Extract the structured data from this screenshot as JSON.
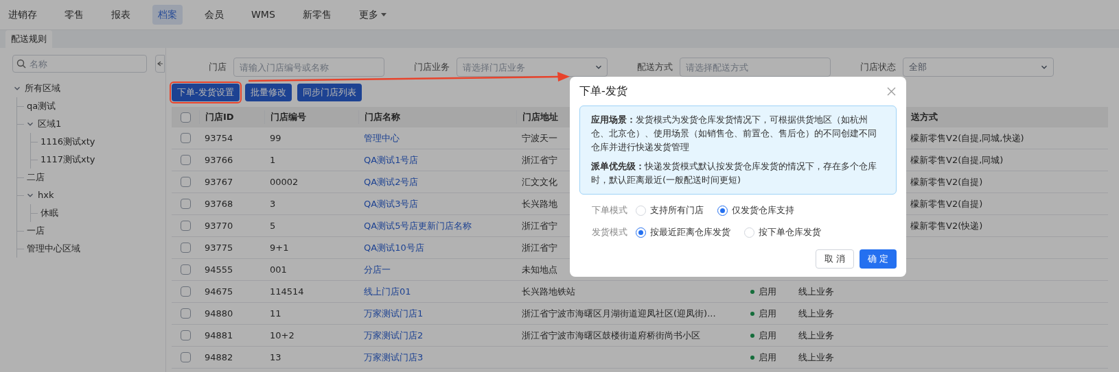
{
  "top_nav": [
    {
      "label": "进销存",
      "selected": false,
      "caret": false
    },
    {
      "label": "零售",
      "selected": false,
      "caret": false
    },
    {
      "label": "报表",
      "selected": false,
      "caret": false
    },
    {
      "label": "档案",
      "selected": true,
      "caret": false
    },
    {
      "label": "会员",
      "selected": false,
      "caret": false
    },
    {
      "label": "WMS",
      "selected": false,
      "caret": false
    },
    {
      "label": "新零售",
      "selected": false,
      "caret": false
    },
    {
      "label": "更多",
      "selected": false,
      "caret": true
    }
  ],
  "tabs": [
    {
      "label": "配送规则",
      "selected": true
    }
  ],
  "sidebar": {
    "search_placeholder": "名称",
    "tree": [
      {
        "label": "所有区域",
        "expanded": true,
        "children": [
          {
            "label": "qa测试"
          },
          {
            "label": "区域1",
            "expanded": true,
            "children": [
              {
                "label": "1116测试xty"
              },
              {
                "label": "1117测试xty"
              }
            ]
          },
          {
            "label": "二店"
          },
          {
            "label": "hxk",
            "expanded": true,
            "children": [
              {
                "label": "休眠"
              }
            ]
          },
          {
            "label": "一店"
          },
          {
            "label": "管理中心区域"
          }
        ]
      }
    ]
  },
  "filters": [
    {
      "label": "门店",
      "kind": "input",
      "placeholder": "请输入门店编号或名称"
    },
    {
      "label": "门店业务",
      "kind": "select",
      "placeholder": "请选择门店业务"
    },
    {
      "label": "配送方式",
      "kind": "input",
      "placeholder": "请选择配送方式"
    },
    {
      "label": "门店状态",
      "kind": "select",
      "value": "全部"
    }
  ],
  "actions": [
    {
      "label": "下单-发货设置",
      "highlighted": true
    },
    {
      "label": "批量修改",
      "highlighted": false
    },
    {
      "label": "同步门店列表",
      "highlighted": false
    }
  ],
  "table": {
    "all_checked": false,
    "columns": [
      "门店ID",
      "门店编号",
      "门店名称",
      "门店地址",
      null,
      null,
      "送方式"
    ],
    "rows": [
      {
        "checked": false,
        "cells": [
          "93754",
          "99",
          "管理中心",
          "宁波天一",
          null,
          null,
          "檬新零售V2(自提,同城,快递)"
        ]
      },
      {
        "checked": false,
        "cells": [
          "93766",
          "1",
          "QA测试1号店",
          "浙江省宁",
          null,
          null,
          "檬新零售V2(自提,同城)"
        ]
      },
      {
        "checked": false,
        "cells": [
          "93767",
          "00002",
          "QA测试2号店",
          "汇文文化",
          null,
          null,
          "檬新零售V2(自提)"
        ]
      },
      {
        "checked": false,
        "cells": [
          "93768",
          "3",
          "QA测试3号店",
          "长兴路地",
          null,
          null,
          "檬新零售V2(自提)"
        ]
      },
      {
        "checked": false,
        "cells": [
          "93770",
          "5",
          "QA测试5号店更新门店名称",
          "浙江省宁",
          null,
          null,
          "檬新零售V2(快递)"
        ]
      },
      {
        "checked": false,
        "cells": [
          "93775",
          "9+1",
          "QA测试10号店",
          "浙江省宁",
          null,
          null,
          null
        ]
      },
      {
        "checked": false,
        "cells": [
          "94555",
          "001",
          "分店一",
          "未知地点",
          null,
          null,
          null
        ]
      },
      {
        "checked": false,
        "cells": [
          "94675",
          "114514",
          "线上门店01",
          "长兴路地铁站",
          "启用",
          "线上业务",
          null
        ]
      },
      {
        "checked": false,
        "cells": [
          "94880",
          "11",
          "万家测试门店1",
          "浙江省宁波市海曙区月湖街道迎凤社区(迎凤街)...",
          "启用",
          "线上业务",
          null
        ]
      },
      {
        "checked": false,
        "cells": [
          "94881",
          "10+2",
          "万家测试门店2",
          "浙江省宁波市海曙区鼓楼街道府桥街尚书小区",
          "启用",
          "线上业务",
          null
        ]
      },
      {
        "checked": false,
        "cells": [
          "94882",
          "13",
          "万家测试门店3",
          null,
          "启用",
          "线上业务",
          null
        ]
      }
    ]
  },
  "modal": {
    "title": "下单-发货",
    "info": [
      "**应用场景：**发货模式为发货仓库发货情况下，可根据供货地区（如杭州仓、北京仓）、使用场景（如销售仓、前置仓、售后仓）的不同创建不同仓库并进行快递发货管理",
      "**派单优先级：**快递发货模式默认按发货仓库发货的情况下，存在多个仓库时，默认距离最近(一般配送时间更短)"
    ],
    "radio_groups": [
      {
        "label": "下单模式",
        "options": [
          {
            "label": "支持所有门店",
            "selected": false
          },
          {
            "label": "仅发货仓库支持",
            "selected": true
          }
        ]
      },
      {
        "label": "发货模式",
        "options": [
          {
            "label": "按最近距离仓库发货",
            "selected": true
          },
          {
            "label": "按下单仓库发货",
            "selected": false
          }
        ]
      }
    ],
    "buttons": [
      {
        "label": "取 消",
        "kind": "default"
      },
      {
        "label": "确 定",
        "kind": "primary"
      }
    ]
  }
}
